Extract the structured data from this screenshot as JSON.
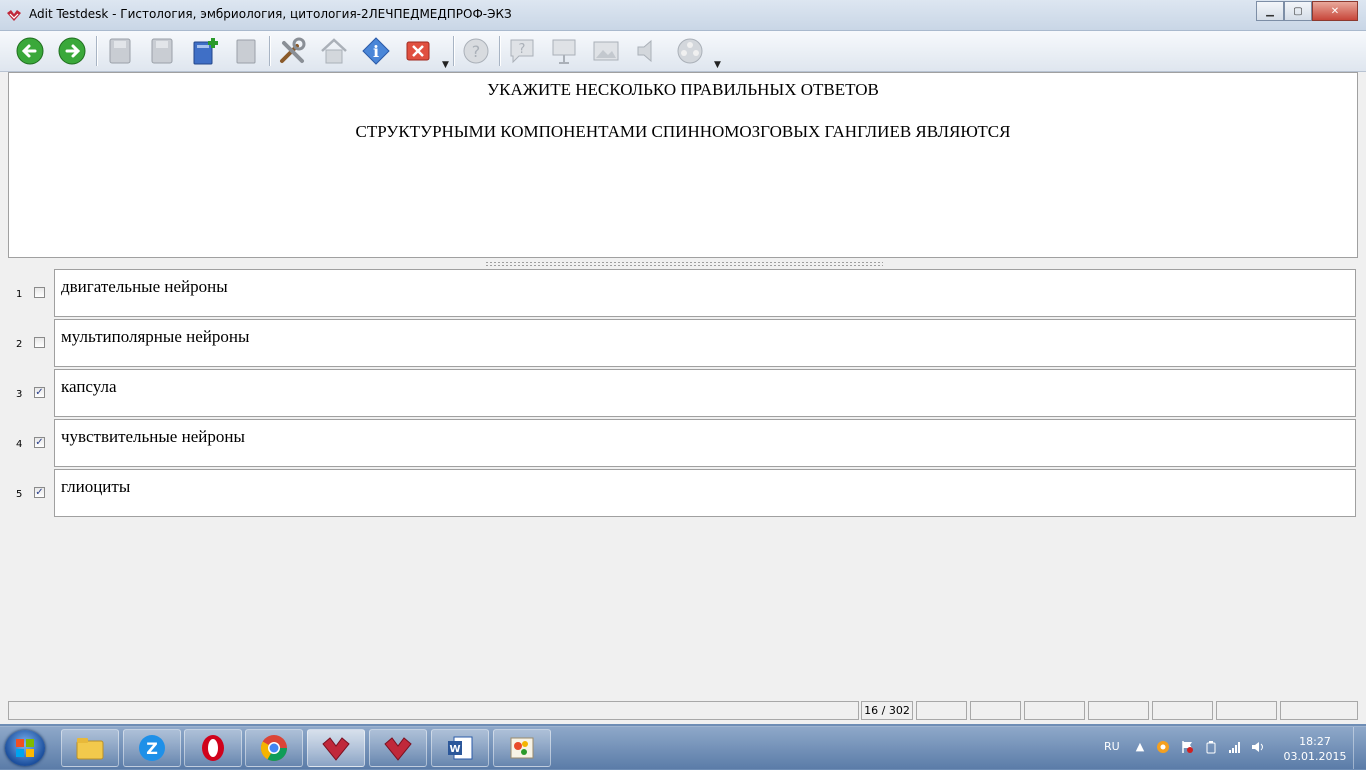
{
  "window": {
    "title": "Adit Testdesk - Гистология, эмбриология, цитология-2ЛЕЧПЕДМЕДПРОФ-ЭКЗ",
    "controls": [
      "minimize-icon",
      "maximize-icon",
      "close-icon"
    ]
  },
  "toolbar": {
    "buttons": [
      {
        "name": "back-button",
        "icon": "arrow-left-icon",
        "enabled": true
      },
      {
        "name": "forward-button",
        "icon": "arrow-right-icon",
        "enabled": true
      },
      {
        "name": "save-button",
        "icon": "floppy-icon",
        "enabled": false
      },
      {
        "name": "save-as-button",
        "icon": "floppy-icon",
        "enabled": false
      },
      {
        "name": "add-button",
        "icon": "book-plus-icon",
        "enabled": true
      },
      {
        "name": "bookmark-button",
        "icon": "book-icon",
        "enabled": false
      },
      {
        "name": "settings-button",
        "icon": "tools-icon",
        "enabled": true
      },
      {
        "name": "home-button",
        "icon": "home-icon",
        "enabled": false
      },
      {
        "name": "info-button",
        "icon": "info-icon",
        "enabled": true
      },
      {
        "name": "close-test-button",
        "icon": "close-box-icon",
        "enabled": true
      },
      {
        "name": "help-button",
        "icon": "help-icon",
        "enabled": false
      },
      {
        "name": "hint-button",
        "icon": "hint-icon",
        "enabled": false
      },
      {
        "name": "presentation-button",
        "icon": "presentation-icon",
        "enabled": false
      },
      {
        "name": "image-button",
        "icon": "image-icon",
        "enabled": false
      },
      {
        "name": "sound-button",
        "icon": "speaker-icon",
        "enabled": false
      },
      {
        "name": "video-button",
        "icon": "film-icon",
        "enabled": false
      }
    ]
  },
  "question": {
    "instruction": "УКАЖИТЕ НЕСКОЛЬКО ПРАВИЛЬНЫХ ОТВЕТОВ",
    "text": "СТРУКТУРНЫМИ КОМПОНЕНТАМИ СПИННОМОЗГОВЫХ ГАНГЛИЕВ ЯВЛЯЮТСЯ"
  },
  "answers": [
    {
      "number": "1",
      "text": "двигательные нейроны",
      "checked": false
    },
    {
      "number": "2",
      "text": "мультиполярные нейроны",
      "checked": false
    },
    {
      "number": "3",
      "text": "капсула",
      "checked": true
    },
    {
      "number": "4",
      "text": "чувствительные нейроны",
      "checked": true
    },
    {
      "number": "5",
      "text": "глиоциты",
      "checked": true
    }
  ],
  "status": {
    "progress": "16 / 302"
  },
  "taskbar": {
    "apps": [
      "explorer-icon",
      "zapya-icon",
      "opera-icon",
      "chrome-icon",
      "testdesk-icon",
      "testdesk-icon",
      "word-icon",
      "paint-icon"
    ],
    "language": "RU",
    "time": "18:27",
    "date": "03.01.2015"
  }
}
